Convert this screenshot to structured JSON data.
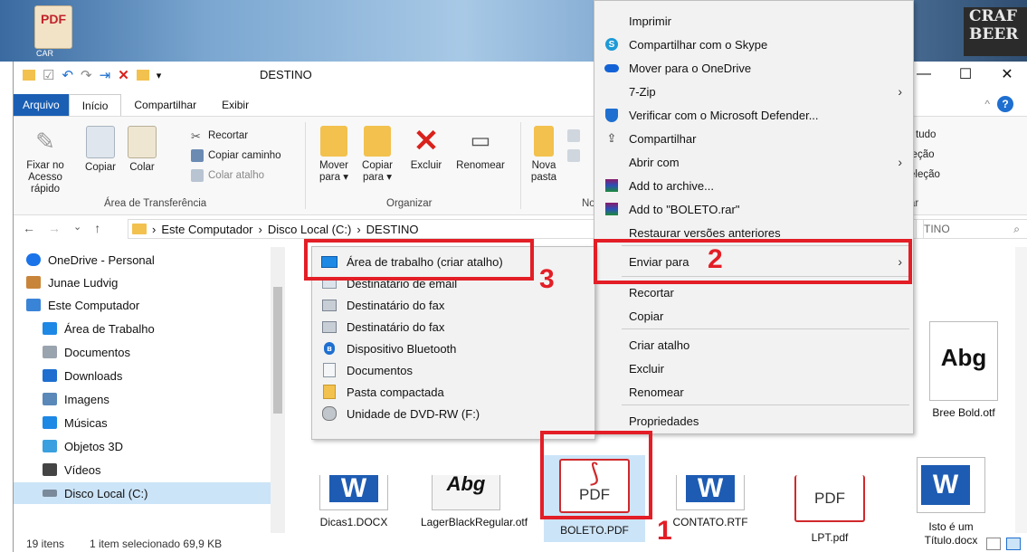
{
  "desktop": {
    "pdf_icon_text": "PDF",
    "partial_label": "CAR",
    "brand": "CRAF BEER"
  },
  "window": {
    "title": "DESTINO",
    "minimize": "—",
    "maximize": "☐",
    "close": "✕"
  },
  "tabs": [
    "Arquivo",
    "Início",
    "Compartilhar",
    "Exibir"
  ],
  "ribbon": {
    "pin": "Fixar no Acesso rápido",
    "copy": "Copiar",
    "paste": "Colar",
    "cut": "Recortar",
    "copy_path": "Copiar caminho",
    "paste_shortcut": "Colar atalho",
    "group_clipboard": "Área de Transferência",
    "move": "Mover para ▾",
    "copy_to": "Copiar para ▾",
    "delete": "Excluir",
    "rename": "Renomear",
    "group_organize": "Organizar",
    "new_folder": "Nova pasta",
    "group_new_partial": "No",
    "right_select_all": "r tudo",
    "right_select_none": "leção",
    "right_invert": "eleção",
    "right_group": "ar"
  },
  "address": {
    "seg1": "Este Computador",
    "seg2": "Disco Local (C:)",
    "seg3": "DESTINO",
    "search": "TINO"
  },
  "nav_pane": [
    {
      "label": "OneDrive - Personal",
      "color": "#1a73e8"
    },
    {
      "label": "Junae Ludvig",
      "color": "#c8853a"
    },
    {
      "label": "Este Computador",
      "color": "#3a84d8"
    },
    {
      "label": "Área de Trabalho",
      "color": "#1e88e5"
    },
    {
      "label": "Documentos",
      "color": "#9aa4ae"
    },
    {
      "label": "Downloads",
      "color": "#1e6fd0"
    },
    {
      "label": "Imagens",
      "color": "#5a88b8"
    },
    {
      "label": "Músicas",
      "color": "#1e88e5"
    },
    {
      "label": "Objetos 3D",
      "color": "#3aa0e0"
    },
    {
      "label": "Vídeos",
      "color": "#444444"
    },
    {
      "label": "Disco Local (C:)",
      "color": "#7a8a9a"
    }
  ],
  "files": [
    {
      "name": "Dicas1.DOCX"
    },
    {
      "name": "LagerBlackRegular.otf"
    },
    {
      "name": "BOLETO.PDF"
    },
    {
      "name": "CONTATO.RTF"
    },
    {
      "name": "LPT.pdf"
    },
    {
      "name": "Isto é um Título.docx"
    },
    {
      "name": "Bree Bold.otf"
    }
  ],
  "file_glyphs": {
    "word": "W",
    "pdf": "PDF",
    "abg": "Abg"
  },
  "status": {
    "count": "19 itens",
    "selected": "1 item selecionado  69,9 KB"
  },
  "context_menu": {
    "items": [
      {
        "label": "Imprimir"
      },
      {
        "label": "Compartilhar com o Skype"
      },
      {
        "label": "Mover para o OneDrive"
      },
      {
        "label": "7-Zip"
      },
      {
        "label": "Verificar com o Microsoft Defender..."
      },
      {
        "label": "Compartilhar"
      },
      {
        "label": "Abrir com"
      },
      {
        "label": "Add to archive..."
      },
      {
        "label": "Add to \"BOLETO.rar\""
      },
      {
        "label": "Restaurar versões anteriores"
      },
      {
        "label": "Enviar para"
      },
      {
        "label": "Recortar"
      },
      {
        "label": "Copiar"
      },
      {
        "label": "Criar atalho"
      },
      {
        "label": "Excluir"
      },
      {
        "label": "Renomear"
      },
      {
        "label": "Propriedades"
      }
    ]
  },
  "send_to_menu": {
    "items": [
      {
        "label": "Área de trabalho (criar atalho)"
      },
      {
        "label": "Destinatário de email"
      },
      {
        "label": "Destinatário do fax"
      },
      {
        "label": "Destinatário do fax"
      },
      {
        "label": "Dispositivo Bluetooth"
      },
      {
        "label": "Documentos"
      },
      {
        "label": "Pasta compactada"
      },
      {
        "label": "Unidade de DVD-RW (F:)"
      }
    ]
  },
  "annotations": {
    "step1": "1",
    "step2": "2",
    "step3": "3"
  },
  "accent_color": "#e31e26"
}
